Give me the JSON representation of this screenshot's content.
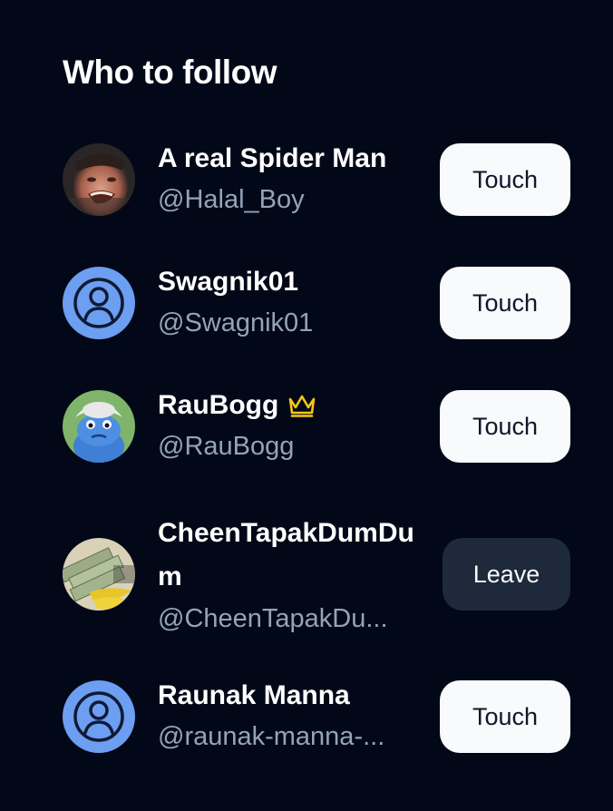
{
  "section": {
    "title": "Who to follow"
  },
  "users": [
    {
      "name": "A real Spider Man",
      "handle": "@Halal_Boy",
      "action": "Touch",
      "avatar": "angry-face-photo"
    },
    {
      "name": "Swagnik01",
      "handle": "@Swagnik01",
      "action": "Touch",
      "avatar": "default-user-icon"
    },
    {
      "name": "RauBogg",
      "handle": "@RauBogg",
      "action": "Touch",
      "avatar": "blue-frog-photo",
      "badge": "crown-icon"
    },
    {
      "name": "CheenTapakDumDum",
      "handle": "@CheenTapakDu...",
      "action": "Leave",
      "avatar": "money-bananas-photo"
    },
    {
      "name": "Raunak Manna",
      "handle": "@raunak-manna-...",
      "action": "Touch",
      "avatar": "default-user-icon"
    }
  ],
  "colors": {
    "background": "#020817",
    "avatar_default": "#6c9ef2",
    "crown": "#f5c518",
    "handle": "#94a3b8"
  }
}
